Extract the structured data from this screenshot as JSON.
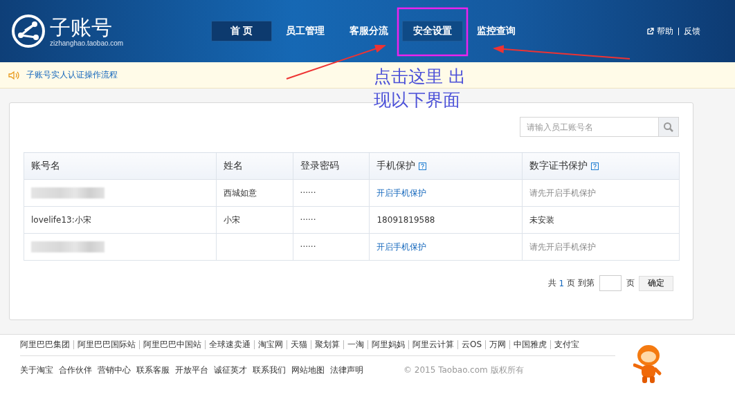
{
  "header": {
    "logo_title": "子账号",
    "logo_domain": "zizhanghao.taobao.com",
    "nav": [
      {
        "label": "首 页",
        "selected": true,
        "hovered": false
      },
      {
        "label": "员工管理",
        "selected": false,
        "hovered": false
      },
      {
        "label": "客服分流",
        "selected": false,
        "hovered": false
      },
      {
        "label": "安全设置",
        "selected": false,
        "hovered": true
      },
      {
        "label": "监控查询",
        "selected": false,
        "hovered": false
      }
    ],
    "help": "帮助",
    "feedback": "反馈"
  },
  "notice": {
    "text": "子账号实人认证操作流程"
  },
  "annotation": {
    "lines": [
      "点击这里 出",
      "现以下界面"
    ]
  },
  "search": {
    "placeholder": "请输入员工账号名"
  },
  "table": {
    "columns": [
      {
        "label": "账号名",
        "help": false
      },
      {
        "label": "姓名",
        "help": false
      },
      {
        "label": "登录密码",
        "help": false
      },
      {
        "label": "手机保护",
        "help": true
      },
      {
        "label": "数字证书保护",
        "help": true
      }
    ],
    "rows": [
      {
        "account": null,
        "name": "西城如意",
        "password": "······",
        "phone": {
          "text": "开启手机保护",
          "kind": "link"
        },
        "cert": {
          "text": "请先开启手机保护",
          "kind": "muted"
        }
      },
      {
        "account": "lovelife13:小宋",
        "name": "小宋",
        "password": "······",
        "phone": {
          "text": "18091819588",
          "kind": "plain"
        },
        "cert": {
          "text": "未安装",
          "kind": "plain"
        }
      },
      {
        "account": null,
        "name": "",
        "password": "······",
        "phone": {
          "text": "开启手机保护",
          "kind": "link"
        },
        "cert": {
          "text": "请先开启手机保护",
          "kind": "muted"
        }
      }
    ]
  },
  "pager": {
    "prefix": "共",
    "total": "1",
    "middle": "页 到第",
    "suffix": "页",
    "confirm": "确定"
  },
  "footer": {
    "partners": [
      "阿里巴巴集团",
      "阿里巴巴国际站",
      "阿里巴巴中国站",
      "全球速卖通",
      "淘宝网",
      "天猫",
      "聚划算",
      "一淘",
      "阿里妈妈",
      "阿里云计算",
      "云OS",
      "万网",
      "中国雅虎",
      "支付宝"
    ],
    "links": [
      "关于淘宝",
      "合作伙伴",
      "营销中心",
      "联系客服",
      "开放平台",
      "诚征英才",
      "联系我们",
      "网站地图",
      "法律声明"
    ],
    "copyright": "© 2015 Taobao.com 版权所有"
  }
}
